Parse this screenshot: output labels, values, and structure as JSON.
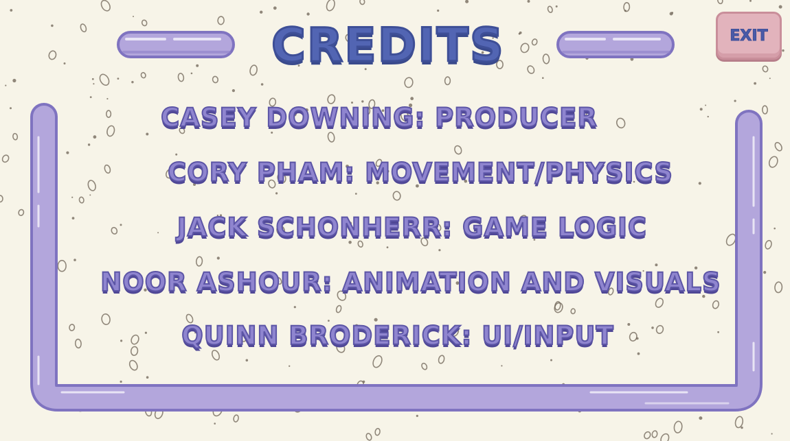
{
  "screen": {
    "title": "CREDITS",
    "exit_label": "EXIT"
  },
  "credits": [
    "CASEY DOWNING: PRODUCER",
    "CORY PHAM: MOVEMENT/PHYSICS",
    "JACK SCHONHERR: GAME LOGIC",
    "NOOR ASHOUR: ANIMATION AND VISUALS",
    "QUINN BRODERICK: UI/INPUT"
  ],
  "colors": {
    "background": "#f7f4e8",
    "frame_fill": "#b3a6dc",
    "frame_outline": "#8478c4",
    "title": "#5265b3",
    "credit_text": "#8f85cf",
    "exit_button": "#e2b3bc",
    "speckle": "#6e6356"
  }
}
